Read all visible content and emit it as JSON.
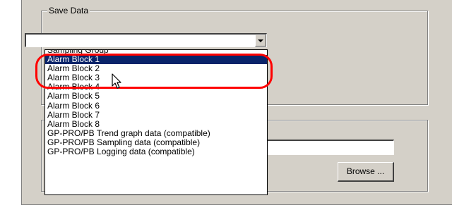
{
  "save_data": {
    "legend": "Save Data",
    "selected_value": "",
    "options": [
      "Sampling Group",
      "Alarm Block 1",
      "Alarm Block 2",
      "Alarm Block 3",
      "Alarm Block 4",
      "Alarm Block 5",
      "Alarm Block 6",
      "Alarm Block 7",
      "Alarm Block 8",
      "GP-PRO/PB Trend graph data (compatible)",
      "GP-PRO/PB Sampling data (compatible)",
      "GP-PRO/PB Logging data (compatible)"
    ],
    "highlighted_option": "Alarm Block 1"
  },
  "file_path": {
    "value": ""
  },
  "browse_button": {
    "label": "Browse ..."
  },
  "colors": {
    "panel_bg": "#d4d0c8",
    "selection_bg": "#0a246a",
    "annotation": "#ff0000"
  },
  "icons": {
    "dropdown_arrow": "chevron-down-icon",
    "cursor": "mouse-pointer-icon"
  }
}
